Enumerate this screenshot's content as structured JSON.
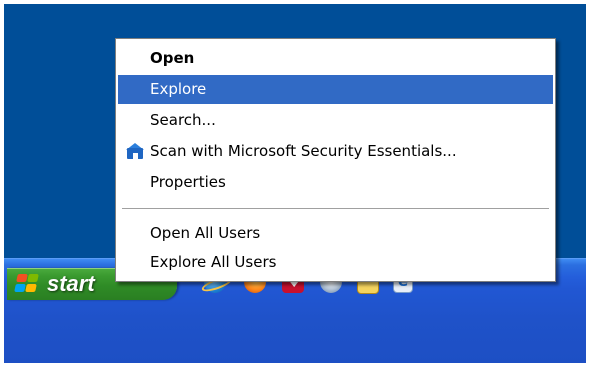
{
  "context_menu": {
    "items": [
      {
        "label": "Open",
        "default": true
      },
      {
        "label": "Explore",
        "highlighted": true
      },
      {
        "label": "Search..."
      },
      {
        "label": "Scan with Microsoft Security Essentials...",
        "icon": "security-essentials-icon"
      },
      {
        "label": "Properties"
      },
      {
        "label": "Open All Users"
      },
      {
        "label": "Explore All Users"
      }
    ]
  },
  "taskbar": {
    "start_label": "start",
    "quick_launch": [
      {
        "icon": "internet-explorer-icon"
      },
      {
        "icon": "firefox-icon"
      },
      {
        "icon": "adobe-reader-icon"
      },
      {
        "icon": "app-icon"
      },
      {
        "icon": "mail-icon"
      },
      {
        "icon": "ie-document-icon"
      }
    ]
  },
  "colors": {
    "desktop": "#004e98",
    "taskbar": "#245edb",
    "start_button": "#3a9a2f",
    "menu_highlight": "#316ac5"
  }
}
